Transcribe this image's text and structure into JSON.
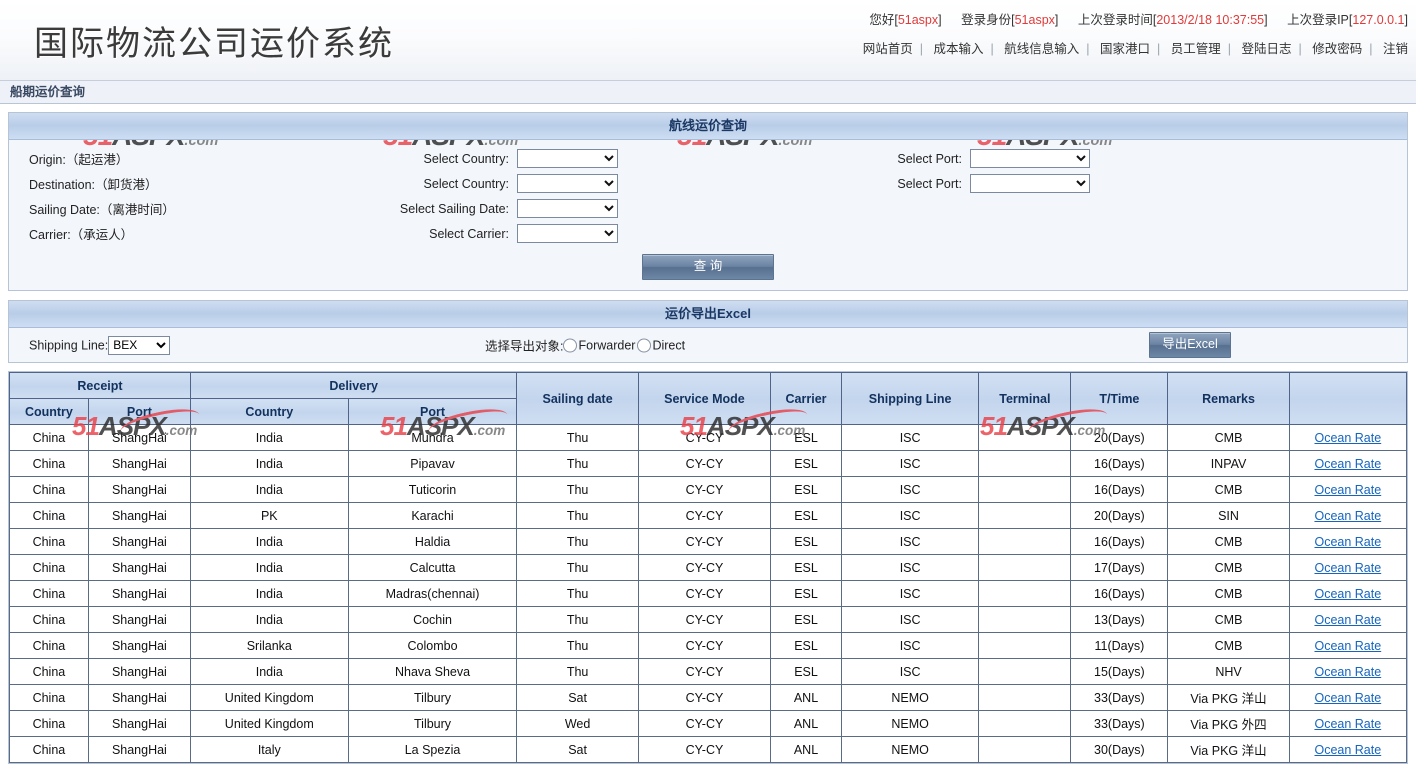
{
  "header": {
    "brand_title": "国际物流公司运价系统",
    "login": {
      "greeting_label": "您好[",
      "greeting_value": "51aspx",
      "greeting_close": "]",
      "identity_label": "登录身份[",
      "identity_value": "51aspx",
      "identity_close": "]",
      "last_time_label": "上次登录时间[",
      "last_time_value": "2013/2/18 10:37:55",
      "last_time_close": "]",
      "last_ip_label": "上次登录IP[",
      "last_ip_value": "127.0.0.1",
      "last_ip_close": "]"
    },
    "nav": [
      {
        "label": "网站首页"
      },
      {
        "label": "成本输入"
      },
      {
        "label": "航线信息输入"
      },
      {
        "label": "国家港口"
      },
      {
        "label": "员工管理"
      },
      {
        "label": "登陆日志"
      },
      {
        "label": "修改密码"
      },
      {
        "label": "注销"
      }
    ],
    "nav_separator": "|"
  },
  "subtitle_bar": "船期运价查询",
  "search_panel": {
    "title": "航线运价查询",
    "rows": [
      {
        "left_label": "Origin:（起运港）",
        "mid_label": "Select Country:",
        "port_label": "Select Port:",
        "has_port": true
      },
      {
        "left_label": "Destination:（卸货港）",
        "mid_label": "Select Country:",
        "port_label": "Select Port:",
        "has_port": true
      },
      {
        "left_label": "Sailing Date:（离港时间）",
        "mid_label": "Select Sailing Date:",
        "port_label": "",
        "has_port": false
      },
      {
        "left_label": "Carrier:（承运人）",
        "mid_label": "Select Carrier:",
        "port_label": "",
        "has_port": false
      }
    ],
    "query_button": "查 询"
  },
  "export_panel": {
    "title": "运价导出Excel",
    "shipping_line_label": "Shipping Line:",
    "shipping_line_value": "BEX",
    "export_target_label": "选择导出对象:",
    "option_forwarder": "Forwarder",
    "option_direct": "Direct",
    "export_button": "导出Excel"
  },
  "results_table": {
    "group_headers": [
      {
        "label": "Receipt",
        "span": 2
      },
      {
        "label": "Delivery",
        "span": 2
      },
      {
        "label": "Sailing date",
        "span": 1
      },
      {
        "label": "Service Mode",
        "span": 1
      },
      {
        "label": "Carrier",
        "span": 1
      },
      {
        "label": "Shipping Line",
        "span": 1
      },
      {
        "label": "Terminal",
        "span": 1
      },
      {
        "label": "T/Time",
        "span": 1
      },
      {
        "label": "Remarks",
        "span": 1
      },
      {
        "label": "",
        "span": 1
      }
    ],
    "sub_headers": [
      "Country",
      "Port",
      "Country",
      "Port"
    ],
    "link_label": "Ocean Rate",
    "rows": [
      {
        "receipt_country": "China",
        "receipt_port": "ShangHai",
        "delivery_country": "India",
        "delivery_port": "Mundra",
        "sailing_date": "Thu",
        "service_mode": "CY-CY",
        "carrier": "ESL",
        "shipping_line": "ISC",
        "terminal": "",
        "ttime": "20(Days)",
        "remarks": "CMB"
      },
      {
        "receipt_country": "China",
        "receipt_port": "ShangHai",
        "delivery_country": "India",
        "delivery_port": "Pipavav",
        "sailing_date": "Thu",
        "service_mode": "CY-CY",
        "carrier": "ESL",
        "shipping_line": "ISC",
        "terminal": "",
        "ttime": "16(Days)",
        "remarks": "INPAV"
      },
      {
        "receipt_country": "China",
        "receipt_port": "ShangHai",
        "delivery_country": "India",
        "delivery_port": "Tuticorin",
        "sailing_date": "Thu",
        "service_mode": "CY-CY",
        "carrier": "ESL",
        "shipping_line": "ISC",
        "terminal": "",
        "ttime": "16(Days)",
        "remarks": "CMB"
      },
      {
        "receipt_country": "China",
        "receipt_port": "ShangHai",
        "delivery_country": "PK",
        "delivery_port": "Karachi",
        "sailing_date": "Thu",
        "service_mode": "CY-CY",
        "carrier": "ESL",
        "shipping_line": "ISC",
        "terminal": "",
        "ttime": "20(Days)",
        "remarks": "SIN"
      },
      {
        "receipt_country": "China",
        "receipt_port": "ShangHai",
        "delivery_country": "India",
        "delivery_port": "Haldia",
        "sailing_date": "Thu",
        "service_mode": "CY-CY",
        "carrier": "ESL",
        "shipping_line": "ISC",
        "terminal": "",
        "ttime": "16(Days)",
        "remarks": "CMB"
      },
      {
        "receipt_country": "China",
        "receipt_port": "ShangHai",
        "delivery_country": "India",
        "delivery_port": "Calcutta",
        "sailing_date": "Thu",
        "service_mode": "CY-CY",
        "carrier": "ESL",
        "shipping_line": "ISC",
        "terminal": "",
        "ttime": "17(Days)",
        "remarks": "CMB"
      },
      {
        "receipt_country": "China",
        "receipt_port": "ShangHai",
        "delivery_country": "India",
        "delivery_port": "Madras(chennai)",
        "sailing_date": "Thu",
        "service_mode": "CY-CY",
        "carrier": "ESL",
        "shipping_line": "ISC",
        "terminal": "",
        "ttime": "16(Days)",
        "remarks": "CMB"
      },
      {
        "receipt_country": "China",
        "receipt_port": "ShangHai",
        "delivery_country": "India",
        "delivery_port": "Cochin",
        "sailing_date": "Thu",
        "service_mode": "CY-CY",
        "carrier": "ESL",
        "shipping_line": "ISC",
        "terminal": "",
        "ttime": "13(Days)",
        "remarks": "CMB"
      },
      {
        "receipt_country": "China",
        "receipt_port": "ShangHai",
        "delivery_country": "Srilanka",
        "delivery_port": "Colombo",
        "sailing_date": "Thu",
        "service_mode": "CY-CY",
        "carrier": "ESL",
        "shipping_line": "ISC",
        "terminal": "",
        "ttime": "11(Days)",
        "remarks": "CMB"
      },
      {
        "receipt_country": "China",
        "receipt_port": "ShangHai",
        "delivery_country": "India",
        "delivery_port": "Nhava Sheva",
        "sailing_date": "Thu",
        "service_mode": "CY-CY",
        "carrier": "ESL",
        "shipping_line": "ISC",
        "terminal": "",
        "ttime": "15(Days)",
        "remarks": "NHV"
      },
      {
        "receipt_country": "China",
        "receipt_port": "ShangHai",
        "delivery_country": "United Kingdom",
        "delivery_port": "Tilbury",
        "sailing_date": "Sat",
        "service_mode": "CY-CY",
        "carrier": "ANL",
        "shipping_line": "NEMO",
        "terminal": "",
        "ttime": "33(Days)",
        "remarks": "Via PKG 洋山"
      },
      {
        "receipt_country": "China",
        "receipt_port": "ShangHai",
        "delivery_country": "United Kingdom",
        "delivery_port": "Tilbury",
        "sailing_date": "Wed",
        "service_mode": "CY-CY",
        "carrier": "ANL",
        "shipping_line": "NEMO",
        "terminal": "",
        "ttime": "33(Days)",
        "remarks": "Via PKG 外四"
      },
      {
        "receipt_country": "China",
        "receipt_port": "ShangHai",
        "delivery_country": "Italy",
        "delivery_port": "La Spezia",
        "sailing_date": "Sat",
        "service_mode": "CY-CY",
        "carrier": "ANL",
        "shipping_line": "NEMO",
        "terminal": "",
        "ttime": "30(Days)",
        "remarks": "Via PKG 洋山"
      }
    ]
  },
  "watermark": {
    "prefix": "51",
    "mid": "ASPX",
    "suffix": ".com"
  },
  "colors": {
    "accent_red": "#e03a3a",
    "link_blue": "#1565c0",
    "header_blue": "#12325e"
  }
}
